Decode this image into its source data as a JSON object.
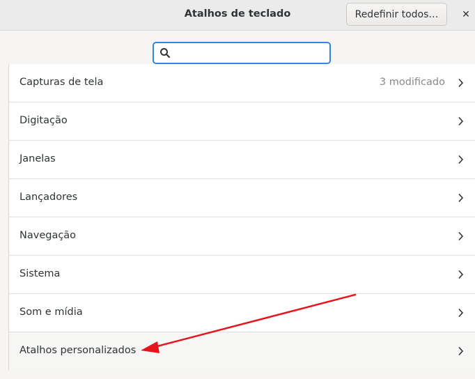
{
  "header": {
    "title": "Atalhos de teclado",
    "reset_label": "Redefinir todos…",
    "close_glyph": "✕"
  },
  "search": {
    "value": "",
    "placeholder": ""
  },
  "categories": [
    {
      "label": "Capturas de tela",
      "status": "3 modificado"
    },
    {
      "label": "Digitação",
      "status": ""
    },
    {
      "label": "Janelas",
      "status": ""
    },
    {
      "label": "Lançadores",
      "status": ""
    },
    {
      "label": "Navegação",
      "status": ""
    },
    {
      "label": "Sistema",
      "status": ""
    },
    {
      "label": "Som e mídia",
      "status": ""
    },
    {
      "label": "Atalhos personalizados",
      "status": ""
    }
  ],
  "colors": {
    "accent": "#3584e4",
    "annotation_arrow": "#e8141d"
  },
  "icons": {
    "search": "search-icon",
    "row_chevron": "chevron-right-icon",
    "close": "close-icon"
  }
}
